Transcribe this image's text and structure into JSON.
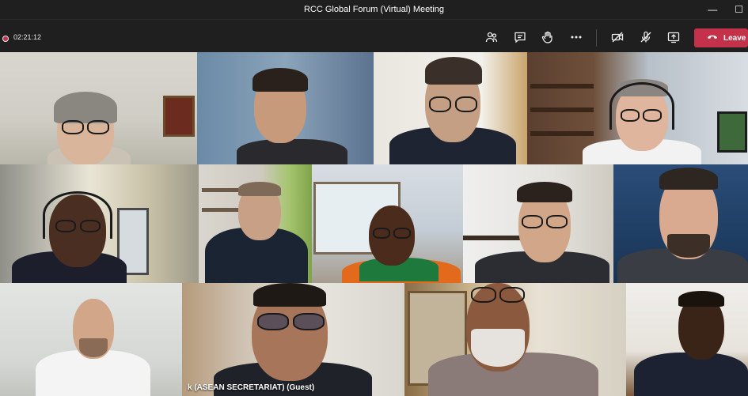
{
  "window": {
    "title": "RCC Global Forum (Virtual) Meeting",
    "minimize_icon": "minimize-icon",
    "maximize_icon": "maximize-icon"
  },
  "toolbar": {
    "timer": "02:21:12",
    "leave_label": "Leave",
    "icons": [
      "participants-icon",
      "chat-icon",
      "raise-hand-icon",
      "more-icon",
      "camera-off-icon",
      "mic-off-icon",
      "share-icon",
      "phone-icon"
    ]
  },
  "participants": {
    "name_tag": "k (ASEAN SECRETARIAT) (Guest)"
  },
  "colors": {
    "leave": "#c4314b",
    "toolbar": "#1f1f1f"
  }
}
